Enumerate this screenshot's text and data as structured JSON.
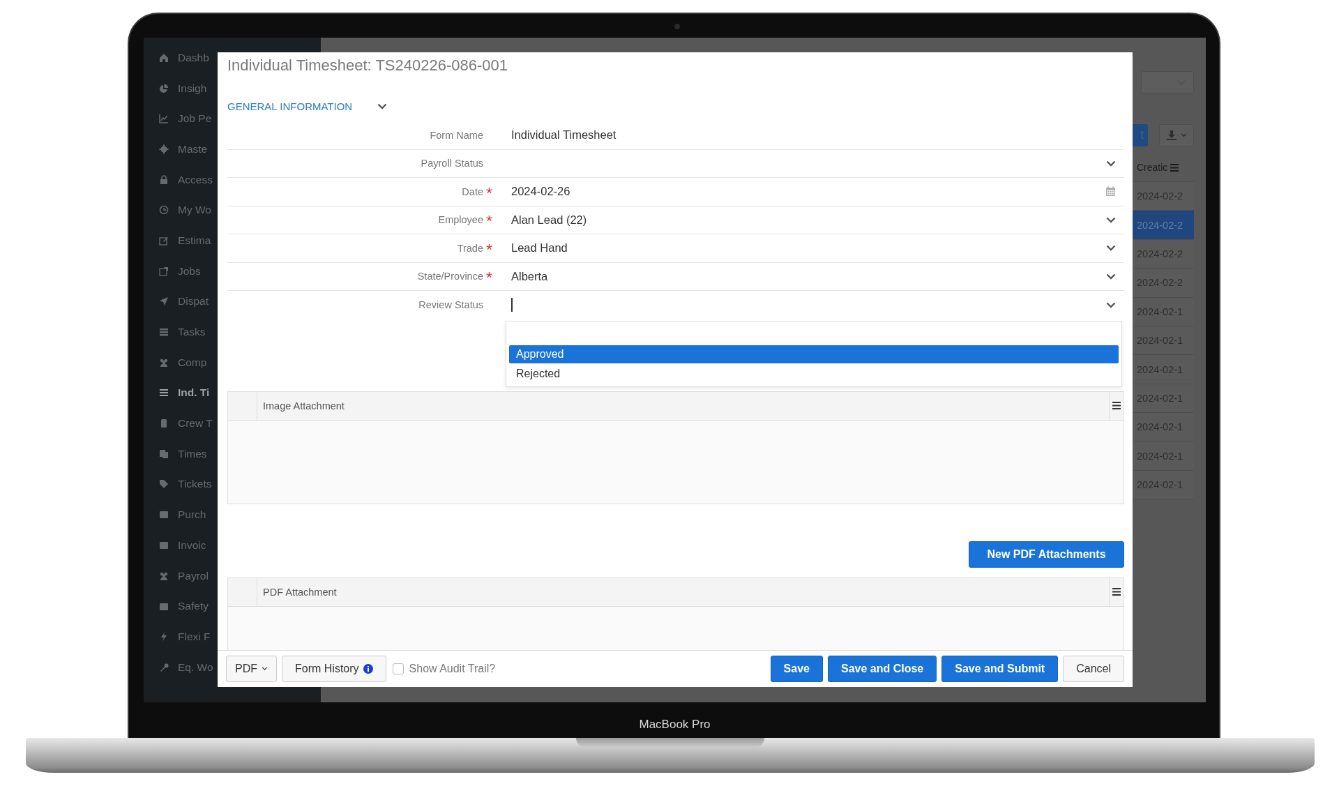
{
  "device": {
    "label": "MacBook Pro"
  },
  "sidebar": {
    "items": [
      {
        "label": "Dashb",
        "selected": false
      },
      {
        "label": "Insigh",
        "selected": false
      },
      {
        "label": "Job Pe",
        "selected": false
      },
      {
        "label": "Maste",
        "selected": false
      },
      {
        "label": "Access",
        "selected": false
      },
      {
        "label": "My Wo",
        "selected": false
      },
      {
        "label": "Estima",
        "selected": false
      },
      {
        "label": "Jobs",
        "selected": false
      },
      {
        "label": "Dispat",
        "selected": false
      },
      {
        "label": "Tasks",
        "selected": false
      },
      {
        "label": "Comp",
        "selected": false
      },
      {
        "label": "Ind. Ti",
        "selected": true
      },
      {
        "label": "Crew T",
        "selected": false
      },
      {
        "label": "Times",
        "selected": false
      },
      {
        "label": "Tickets",
        "selected": false
      },
      {
        "label": "Purch",
        "selected": false
      },
      {
        "label": "Invoic",
        "selected": false
      },
      {
        "label": "Payrol",
        "selected": false
      },
      {
        "label": "Safety",
        "selected": false
      },
      {
        "label": "Flexi F",
        "selected": false
      },
      {
        "label": "Eq. Wo",
        "selected": false
      }
    ]
  },
  "background_list": {
    "primary_button": "t",
    "table": {
      "column_header": "Creatic",
      "rows": [
        {
          "created": "2024-02-2",
          "selected": false
        },
        {
          "created": "2024-02-2",
          "selected": true
        },
        {
          "created": "2024-02-2",
          "selected": false
        },
        {
          "created": "2024-02-2",
          "selected": false
        },
        {
          "created": "2024-02-1",
          "selected": false
        },
        {
          "created": "2024-02-1",
          "selected": false
        },
        {
          "created": "2024-02-1",
          "selected": false
        },
        {
          "created": "2024-02-1",
          "selected": false
        },
        {
          "created": "2024-02-1",
          "selected": false
        },
        {
          "created": "2024-02-1",
          "selected": false
        },
        {
          "created": "2024-02-1",
          "selected": false
        }
      ]
    }
  },
  "modal": {
    "title": "Individual Timesheet: TS240226-086-001",
    "section": {
      "label": "GENERAL INFORMATION",
      "expanded": true
    },
    "fields": [
      {
        "label": "Form Name",
        "value": "Individual Timesheet",
        "required": false,
        "kind": "text"
      },
      {
        "label": "Payroll Status",
        "required": false,
        "kind": "select"
      },
      {
        "label": "Date",
        "value": "2024-02-26",
        "required": true,
        "kind": "date"
      },
      {
        "label": "Employee",
        "value": "Alan Lead (22)",
        "required": true,
        "kind": "select"
      },
      {
        "label": "Trade",
        "value": "Lead Hand",
        "required": true,
        "kind": "select"
      },
      {
        "label": "State/Province",
        "value": "Alberta",
        "required": true,
        "kind": "select"
      },
      {
        "label": "Review Status",
        "required": false,
        "kind": "select",
        "focused": true
      }
    ],
    "dropdown": {
      "options": [
        {
          "label": "Approved",
          "selected": true
        },
        {
          "label": "Rejected",
          "selected": false
        }
      ]
    },
    "image_grid": {
      "header": "Image Attachment"
    },
    "new_pdf_button": "New PDF Attachments",
    "pdf_grid": {
      "header": "PDF Attachment"
    },
    "footer": {
      "pdf_menu": "PDF",
      "form_history": "Form History",
      "audit_trail": {
        "label": "Show Audit Trail?",
        "checked": false
      },
      "buttons": [
        {
          "label": "Save",
          "kind": "primary"
        },
        {
          "label": "Save and Close",
          "kind": "primary"
        },
        {
          "label": "Save and Submit",
          "kind": "primary"
        },
        {
          "label": "Cancel",
          "kind": "default"
        }
      ]
    }
  }
}
